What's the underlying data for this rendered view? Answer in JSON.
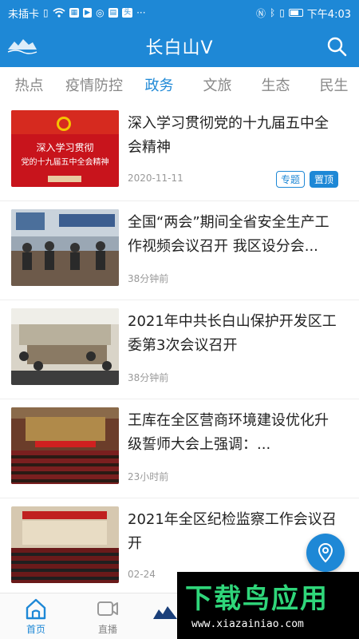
{
  "status_bar": {
    "carrier": "未插卡",
    "time": "下午4:03",
    "icons": [
      "sim-icon",
      "wifi-icon",
      "wechat-icon",
      "bluetooth-icon",
      "vibrate-icon",
      "battery-icon"
    ]
  },
  "header": {
    "title": "长白山V",
    "logo_icon": "mountain-logo-icon",
    "search_icon": "search-icon"
  },
  "tabs": [
    {
      "label": "热点"
    },
    {
      "label": "疫情防控"
    },
    {
      "label": "政务",
      "active": true
    },
    {
      "label": "文旅"
    },
    {
      "label": "生态"
    },
    {
      "label": "民生"
    }
  ],
  "news": [
    {
      "title": "深入学习贯彻党的十九届五中全会精神",
      "time": "2020-11-11",
      "tag_topic": "专题",
      "tag_pinned": "置顶",
      "thumb_text_1": "深入学习贯彻",
      "thumb_text_2": "党的十九届五中全会精神"
    },
    {
      "title": "全国“两会”期间全省安全生产工作视频会议召开 我区设分会...",
      "time": "38分钟前"
    },
    {
      "title": "2021年中共长白山保护开发区工委第3次会议召开",
      "time": "38分钟前"
    },
    {
      "title": "王库在全区营商环境建设优化升级誓师大会上强调：...",
      "time": "23小时前"
    },
    {
      "title": "2021年全区纪检监察工作会议召开",
      "time": "02-24"
    }
  ],
  "fab": {
    "icon": "location-pin-icon"
  },
  "bottom_nav": [
    {
      "label": "首页",
      "icon": "home-icon",
      "active": true
    },
    {
      "label": "直播",
      "icon": "video-camera-icon"
    }
  ],
  "watermark": {
    "brand": "下载鸟应用",
    "url": "www.xiazainiao.com"
  },
  "colors": {
    "accent": "#1e88d6",
    "text": "#222222",
    "muted": "#888888"
  }
}
